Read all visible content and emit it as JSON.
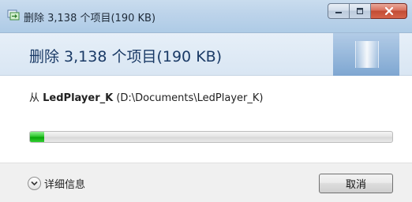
{
  "window": {
    "title": "删除 3,138 个项目(190 KB)",
    "icon": "file-operation-icon"
  },
  "caption_buttons": {
    "minimize_icon": "minimize-icon",
    "maximize_icon": "maximize-icon",
    "close_icon": "close-icon"
  },
  "header": {
    "title": "删除 3,138 个项目(190 KB)"
  },
  "operation": {
    "from_prefix": "从 ",
    "source_name": "LedPlayer_K",
    "source_path": " (D:\\Documents\\LedPlayer_K)"
  },
  "progress": {
    "value": 0.04,
    "color": "#22bb22"
  },
  "footer": {
    "details_label": "详细信息",
    "details_icon": "chevron-down-icon",
    "cancel_label": "取消"
  }
}
